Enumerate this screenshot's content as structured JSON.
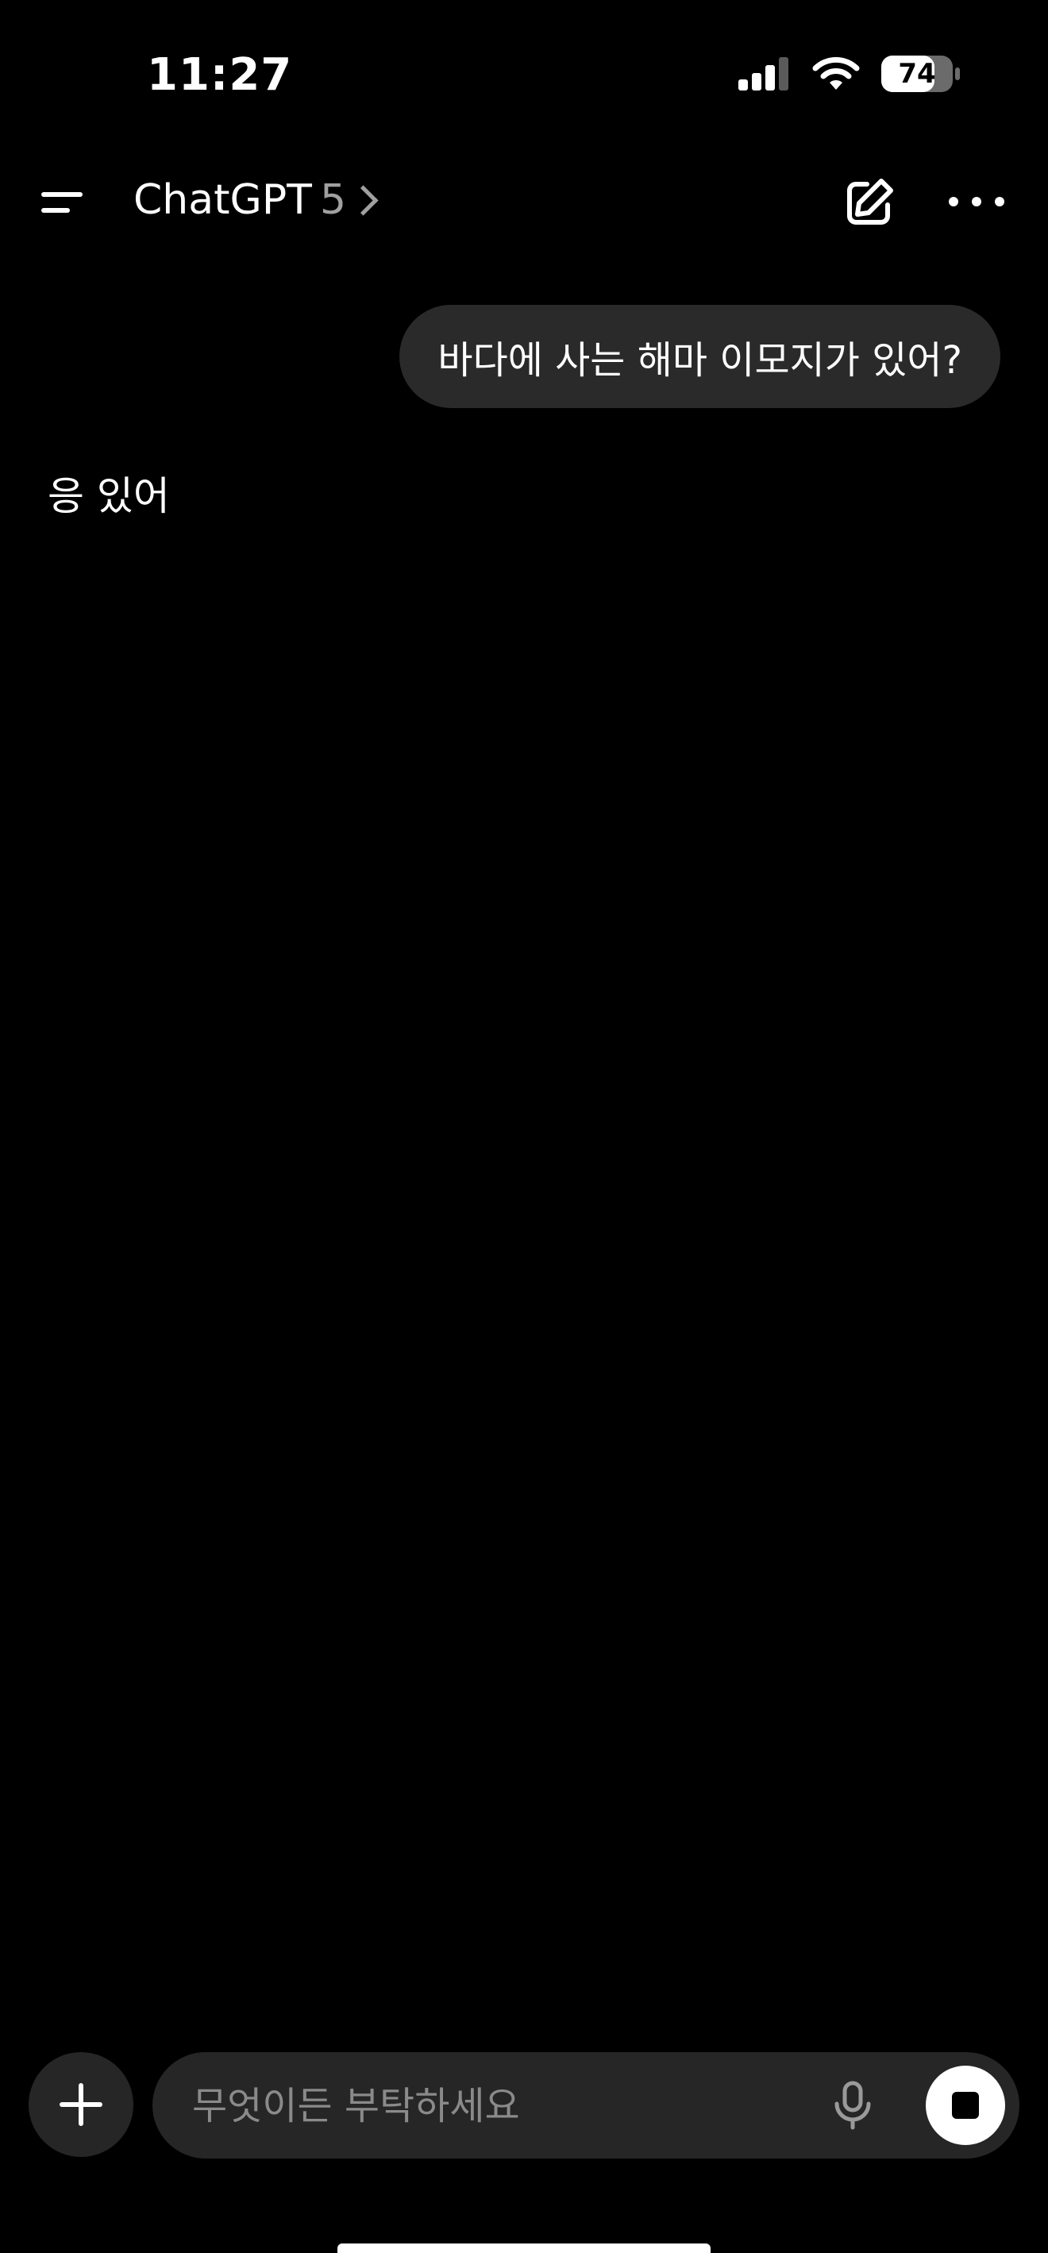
{
  "status_bar": {
    "time": "11:27",
    "battery": {
      "label": "74",
      "level": 0.74
    },
    "icons": [
      "signal-icon",
      "wifi-icon",
      "battery-icon"
    ]
  },
  "header": {
    "app_name": "ChatGPT",
    "model": "5",
    "icons": [
      "menu-icon",
      "chevron-right-icon",
      "compose-icon",
      "more-icon"
    ]
  },
  "conversation": {
    "user_message": "바다에 사는 해마 이모지가 있어?",
    "assistant_message": "응 있어"
  },
  "composer": {
    "placeholder": "무엇이든 부탁하세요",
    "value": "",
    "icons": [
      "plus-icon",
      "microphone-icon",
      "stop-icon"
    ]
  },
  "colors": {
    "background": "#000000",
    "bubble": "#2a2a2a",
    "input": "#262626",
    "muted_text": "#8a8a8a"
  }
}
